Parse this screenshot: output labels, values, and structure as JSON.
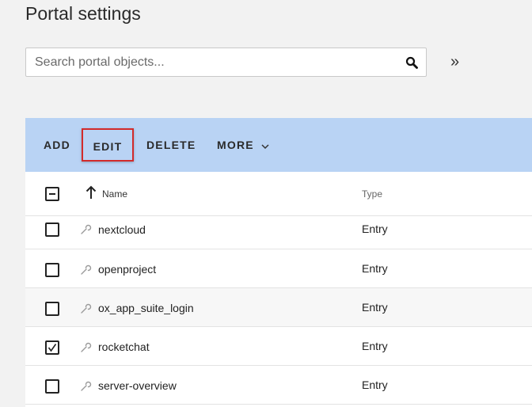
{
  "page": {
    "title": "Portal settings"
  },
  "search": {
    "placeholder": "Search portal objects...",
    "value": ""
  },
  "toolbar": {
    "add_label": "ADD",
    "edit_label": "EDIT",
    "delete_label": "DELETE",
    "more_label": "MORE"
  },
  "table": {
    "columns": {
      "name": "Name",
      "type": "Type"
    },
    "rows": [
      {
        "name": "nextcloud",
        "type": "Entry",
        "checked": false
      },
      {
        "name": "openproject",
        "type": "Entry",
        "checked": false
      },
      {
        "name": "ox_app_suite_login",
        "type": "Entry",
        "checked": false
      },
      {
        "name": "rocketchat",
        "type": "Entry",
        "checked": true
      },
      {
        "name": "server-overview",
        "type": "Entry",
        "checked": false
      }
    ]
  },
  "colors": {
    "toolbar_bg": "#b9d3f4",
    "highlight_border": "#d22b2b",
    "page_bg": "#f2f2f2"
  },
  "icons": [
    "search-icon",
    "collapse-double-chevron-icon",
    "chevron-down-icon",
    "sort-ascending-icon",
    "wrench-icon",
    "checkbox-indeterminate-icon",
    "checkbox-checked-icon"
  ]
}
